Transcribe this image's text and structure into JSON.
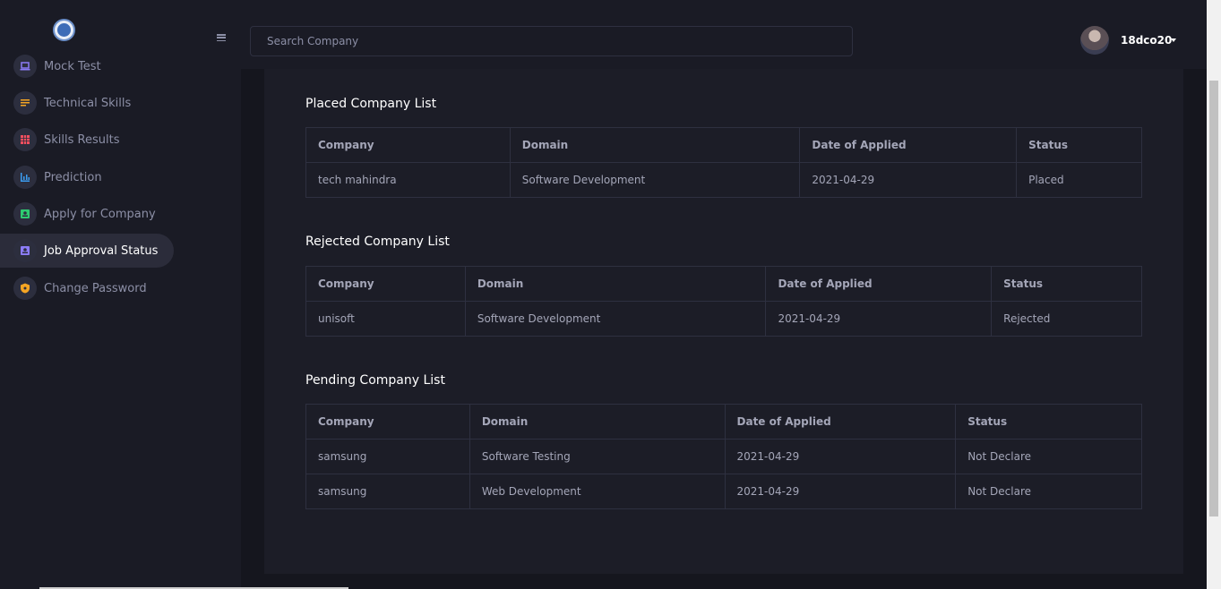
{
  "sidebar": {
    "items": [
      {
        "label": "Mock Test",
        "icon": "laptop-icon",
        "color": "#8b7cf6"
      },
      {
        "label": "Technical Skills",
        "icon": "list-icon",
        "color": "#f5a524"
      },
      {
        "label": "Skills Results",
        "icon": "grid-icon",
        "color": "#f04f5f"
      },
      {
        "label": "Prediction",
        "icon": "bar-chart-icon",
        "color": "#3b9cf0"
      },
      {
        "label": "Apply for Company",
        "icon": "contact-icon",
        "color": "#2ecc71"
      },
      {
        "label": "Job Approval Status",
        "icon": "badge-icon",
        "color": "#8b7cf6",
        "active": true
      },
      {
        "label": "Change Password",
        "icon": "shield-icon",
        "color": "#f5a524"
      }
    ]
  },
  "header": {
    "search_placeholder": "Search Company",
    "username": "18dco20"
  },
  "sections": [
    {
      "title": "Placed Company List",
      "columns": [
        "Company",
        "Domain",
        "Date of Applied",
        "Status"
      ],
      "rows": [
        [
          "tech mahindra",
          "Software Development",
          "2021-04-29",
          "Placed"
        ]
      ]
    },
    {
      "title": "Rejected Company List",
      "columns": [
        "Company",
        "Domain",
        "Date of Applied",
        "Status"
      ],
      "rows": [
        [
          "unisoft",
          "Software Development",
          "2021-04-29",
          "Rejected"
        ]
      ]
    },
    {
      "title": "Pending Company List",
      "columns": [
        "Company",
        "Domain",
        "Date of Applied",
        "Status"
      ],
      "rows": [
        [
          "samsung",
          "Software Testing",
          "2021-04-29",
          "Not Declare"
        ],
        [
          "samsung",
          "Web Development",
          "2021-04-29",
          "Not Declare"
        ]
      ]
    }
  ]
}
